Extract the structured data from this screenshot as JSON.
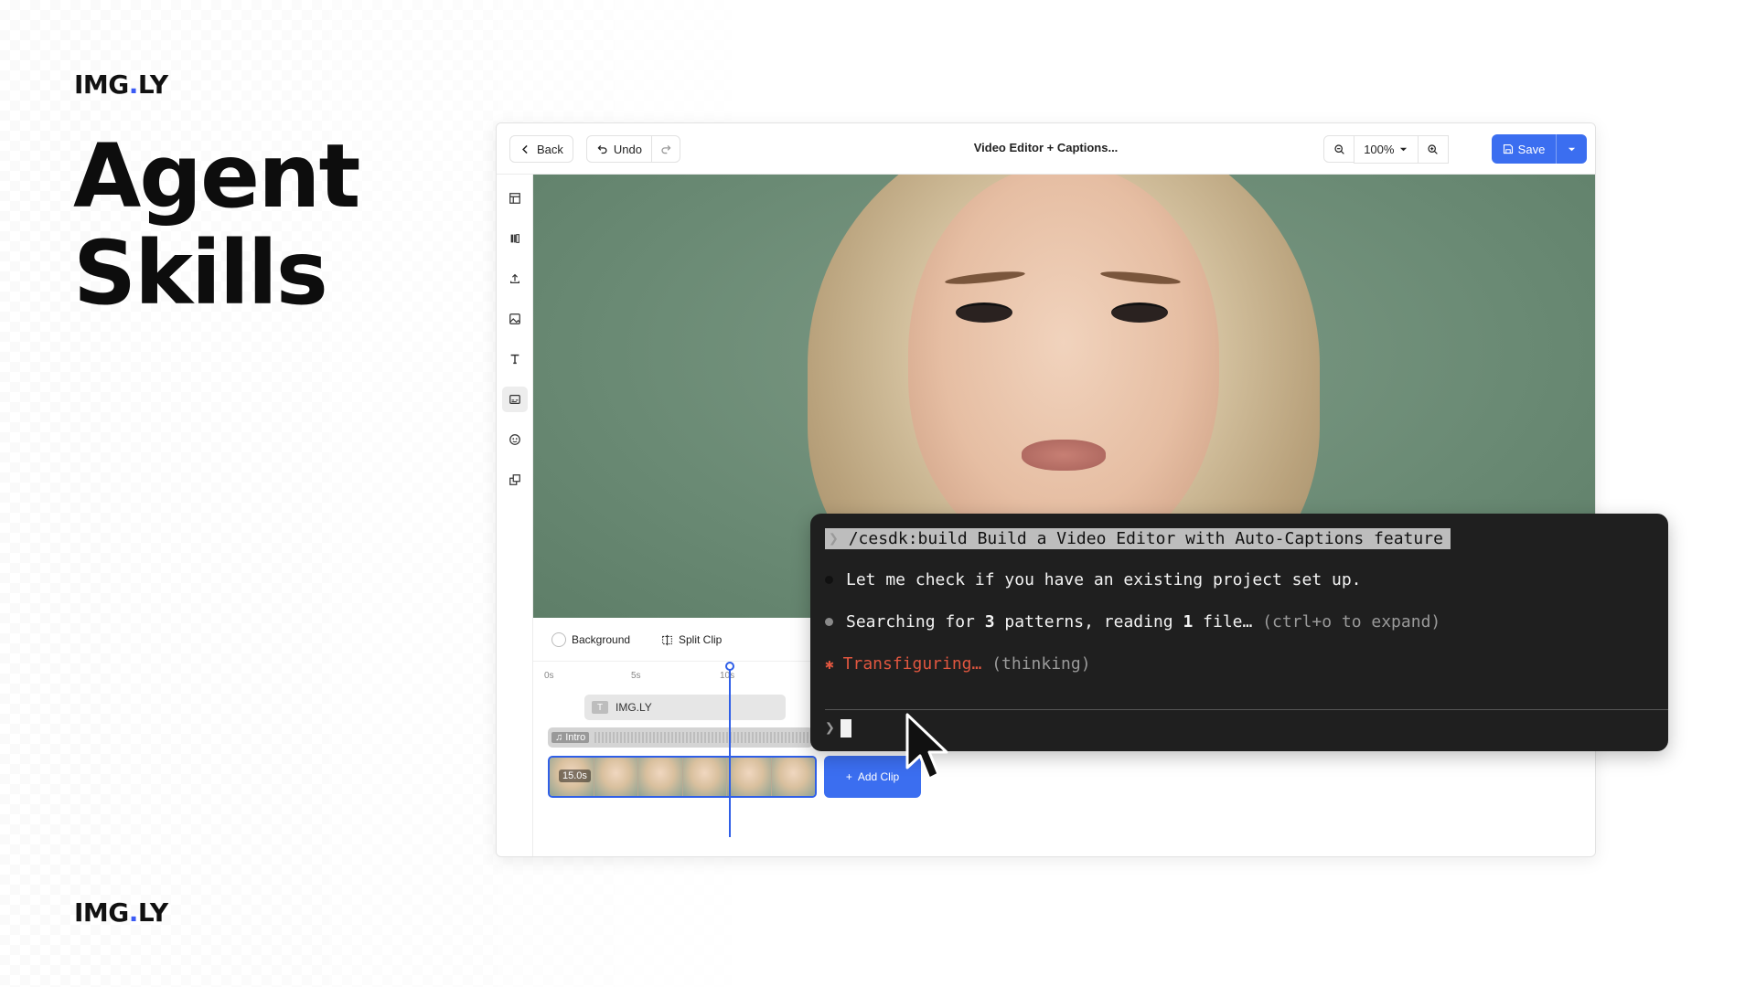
{
  "brand": {
    "logo_prefix": "IMG",
    "logo_dot": ".",
    "logo_suffix": "LY",
    "accent": "#3b5bf5"
  },
  "headline": {
    "line1": "Agent",
    "line2": "Skills"
  },
  "editor": {
    "back_label": "Back",
    "undo_label": "Undo",
    "title": "Video Editor + Captions...",
    "zoom_level": "100%",
    "save_label": "Save",
    "accent": "#3b6ef0",
    "sidebar_icons": [
      "layout-icon",
      "library-icon",
      "upload-icon",
      "image-icon",
      "text-icon",
      "caption-icon",
      "sticker-icon",
      "shapes-icon"
    ]
  },
  "timeline": {
    "background_label": "Background",
    "split_clip_label": "Split Clip",
    "ruler": [
      "0s",
      "5s",
      "10s"
    ],
    "text_track_label": "IMG.LY",
    "audio_track_label": "Intro",
    "video_duration": "15.0s",
    "add_clip_label": "Add Clip"
  },
  "terminal": {
    "command": "/cesdk:build Build a Video Editor with Auto-Captions feature",
    "line2": "Let me check if you have an existing project set up.",
    "line3_pre": "Searching for ",
    "line3_num1": "3",
    "line3_mid": " patterns, reading ",
    "line3_num2": "1",
    "line3_post": " file…",
    "line3_hint": " (ctrl+o to expand)",
    "line4_status": "Transfiguring…",
    "line4_hint": " (thinking)",
    "prompt_symbol": "❯",
    "status_color": "#e0563f"
  }
}
